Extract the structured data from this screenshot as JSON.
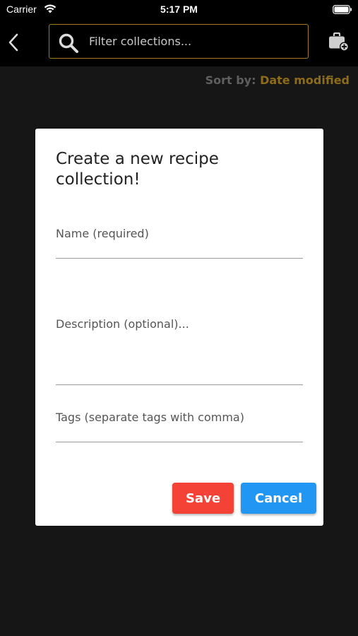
{
  "status_bar": {
    "carrier": "Carrier",
    "time": "5:17 PM"
  },
  "header": {
    "search": {
      "placeholder": "Filter collections...",
      "value": ""
    },
    "icons": {
      "back": "chevron-left-icon",
      "search": "magnifier-icon",
      "add": "briefcase-plus-icon"
    }
  },
  "sort": {
    "label": "Sort by:",
    "value": "Date modified"
  },
  "dialog": {
    "title": "Create a new recipe collection!",
    "name_placeholder": "Name (required)",
    "description_placeholder": "Description (optional)...",
    "tags_placeholder": "Tags (separate tags with comma)",
    "save_label": "Save",
    "cancel_label": "Cancel"
  },
  "colors": {
    "background": "#161616",
    "header": "#000000",
    "accent_gold": "#8c6c1a",
    "search_border": "#a27b1a",
    "save": "#f44336",
    "cancel": "#2196f3"
  }
}
